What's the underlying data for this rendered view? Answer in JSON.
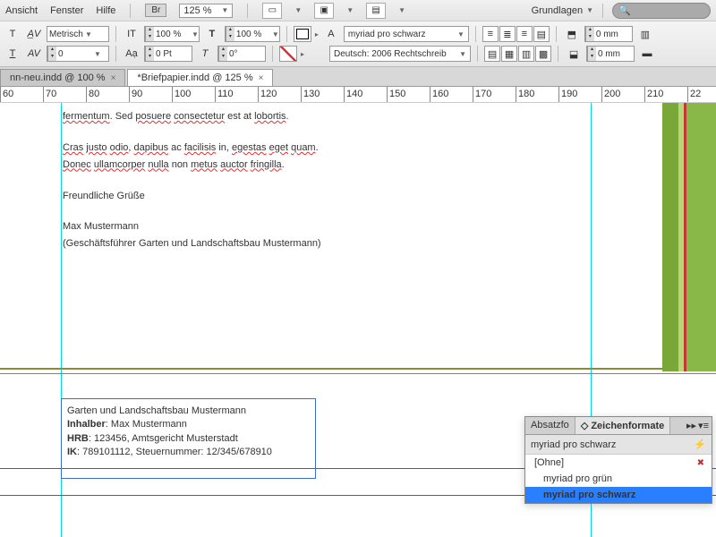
{
  "menu": {
    "ansicht": "Ansicht",
    "fenster": "Fenster",
    "hilfe": "Hilfe",
    "br": "Br",
    "zoom": "125 %",
    "workspace": "Grundlagen"
  },
  "toolbar": {
    "metrics": "Metrisch",
    "metrics_val": "0",
    "scale_x": "100 %",
    "scale_y": "100 %",
    "baseline": "0 Pt",
    "font": "myriad pro schwarz",
    "lang": "Deutsch: 2006 Rechtschreib",
    "inset_top": "0 mm",
    "inset_bottom": "0 mm"
  },
  "tabs": [
    {
      "label": "nn-neu.indd @ 100 %",
      "active": false
    },
    {
      "label": "*Briefpapier.indd @ 125 %",
      "active": true
    }
  ],
  "ruler": [
    "60",
    "70",
    "80",
    "90",
    "100",
    "110",
    "120",
    "130",
    "140",
    "150",
    "160",
    "170",
    "180",
    "190",
    "200",
    "210",
    "22"
  ],
  "doc": {
    "l1a": "fermentum",
    "l1b": ". Sed ",
    "l1c": "posuere",
    "l1d": " ",
    "l1e": "consectetur",
    "l1f": " est at ",
    "l1g": "lobortis",
    "l1h": ".",
    "l2a": "Cras",
    "l2b": " ",
    "l2c": "justo",
    "l2d": " ",
    "l2e": "odio",
    "l2f": ", ",
    "l2g": "dapibus",
    "l2h": " ac ",
    "l2i": "facilisis",
    "l2j": " in, ",
    "l2k": "egestas",
    "l2l": " ",
    "l2m": "eget",
    "l2n": " ",
    "l2o": "quam",
    "l2p": ".",
    "l3a": "Donec",
    "l3b": " ",
    "l3c": "ullamcorper",
    "l3d": " ",
    "l3e": "nulla",
    "l3f": " non ",
    "l3g": "metus",
    "l3h": " ",
    "l3i": "auctor",
    "l3j": " ",
    "l3k": "fringilla",
    "l3l": ".",
    "greeting": "Freundliche Grüße",
    "name": "Max Mustermann",
    "role": "(Geschäftsführer Garten und Landschaftsbau Mustermann)"
  },
  "footer": {
    "company": "Garten und Landschaftsbau Mustermann",
    "owner_lbl": "Inhalber",
    "owner": ": Max Mustermann",
    "hrb_lbl": "HRB",
    "hrb": ": 123456, Amtsgericht Musterstadt",
    "ik_lbl": "IK",
    "ik": ": 789101112, Steuernummer: 12/345/678910"
  },
  "panel": {
    "tab1": "Absatzfo",
    "tab2": "Zeichenformate",
    "current": "myriad pro schwarz",
    "items": [
      {
        "label": "[Ohne]",
        "none": true
      },
      {
        "label": "myriad pro grün"
      },
      {
        "label": "myriad pro schwarz",
        "sel": true
      }
    ]
  }
}
